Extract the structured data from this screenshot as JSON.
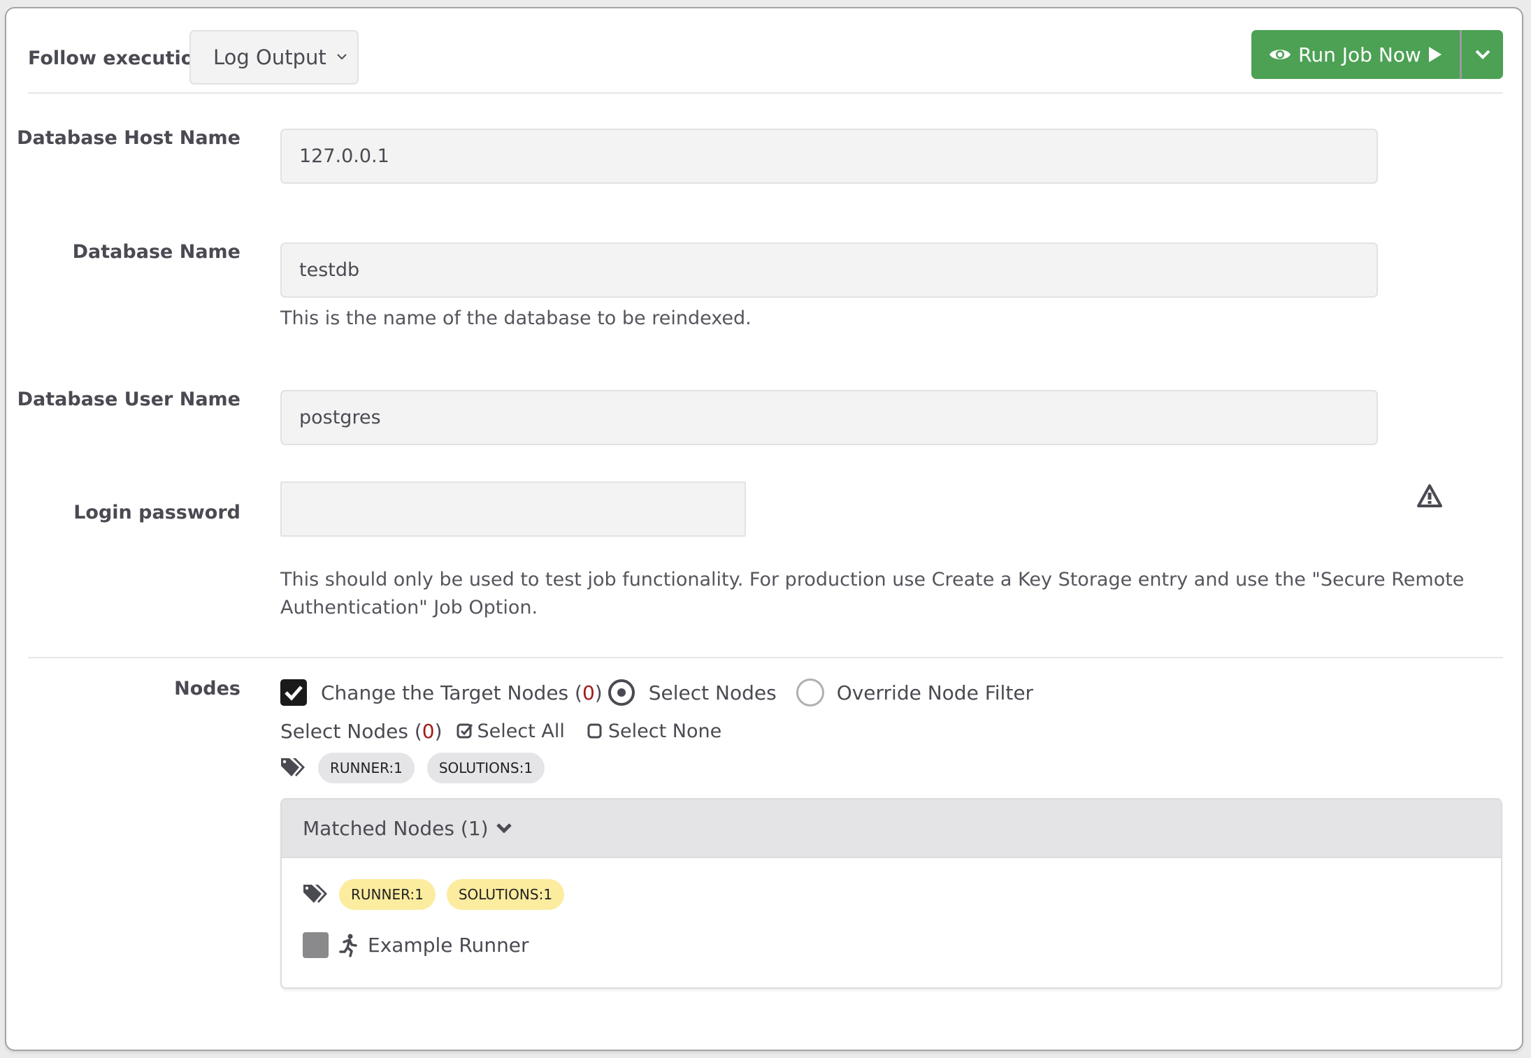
{
  "header": {
    "follow_label": "Follow execution",
    "follow_select": {
      "selected": "Log Output"
    },
    "run_button": {
      "label": "Run Job Now",
      "color": "#4ca154"
    }
  },
  "fields": [
    {
      "label": "Database Host Name",
      "value": "127.0.0.1",
      "help": ""
    },
    {
      "label": "Database Name",
      "value": "testdb",
      "help": "This is the name of the database to be reindexed."
    },
    {
      "label": "Database User Name",
      "value": "postgres",
      "help": ""
    },
    {
      "label": "Login password",
      "value": "",
      "help_line1": "This should only be used to test job functionality. For production use Create a Key Storage entry and use the \"Secure Remote",
      "help_line2": "Authentication\" Job Option."
    }
  ],
  "nodes": {
    "label": "Nodes",
    "change_target": {
      "label": "Change the Target Nodes (",
      "count": "0",
      "close": ")",
      "checked": true
    },
    "radio_select": {
      "label": "Select Nodes",
      "selected": true
    },
    "radio_override": {
      "label": "Override Node Filter",
      "selected": false
    },
    "select_nodes": {
      "label": "Select Nodes (",
      "count": "0",
      "close": ")"
    },
    "select_all": "Select All",
    "select_none": "Select None",
    "tags": [
      "RUNNER:1",
      "SOLUTIONS:1"
    ],
    "matched": {
      "title": "Matched Nodes (1)",
      "tags": [
        "RUNNER:1",
        "SOLUTIONS:1"
      ],
      "items": [
        {
          "name": "Example Runner",
          "checked": false
        }
      ]
    }
  },
  "colors": {
    "count_red": "#a21b1b",
    "tag_yellow": "#fcec9f",
    "tag_gray": "#e5e5e8"
  }
}
